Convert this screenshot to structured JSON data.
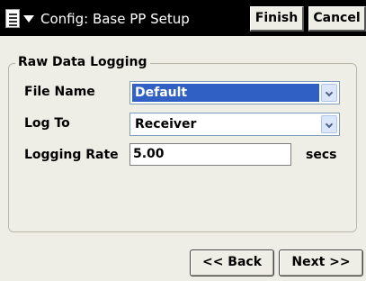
{
  "title_bar": {
    "title": "Config: Base PP Setup",
    "finish_label": "Finish",
    "cancel_label": "Cancel",
    "menu_icon": "document-menu-icon"
  },
  "raw_data_logging": {
    "group_title": "Raw Data Logging",
    "file_name": {
      "label": "File Name",
      "value": "Default"
    },
    "log_to": {
      "label": "Log To",
      "value": "Receiver"
    },
    "logging_rate": {
      "label": "Logging Rate",
      "value": "5.00",
      "unit": "secs"
    }
  },
  "nav": {
    "back_label": "<< Back",
    "next_label": "Next >>"
  },
  "colors": {
    "title_bar_bg": "#000000",
    "dialog_bg": "#efeee6",
    "selection": "#3160c4"
  }
}
